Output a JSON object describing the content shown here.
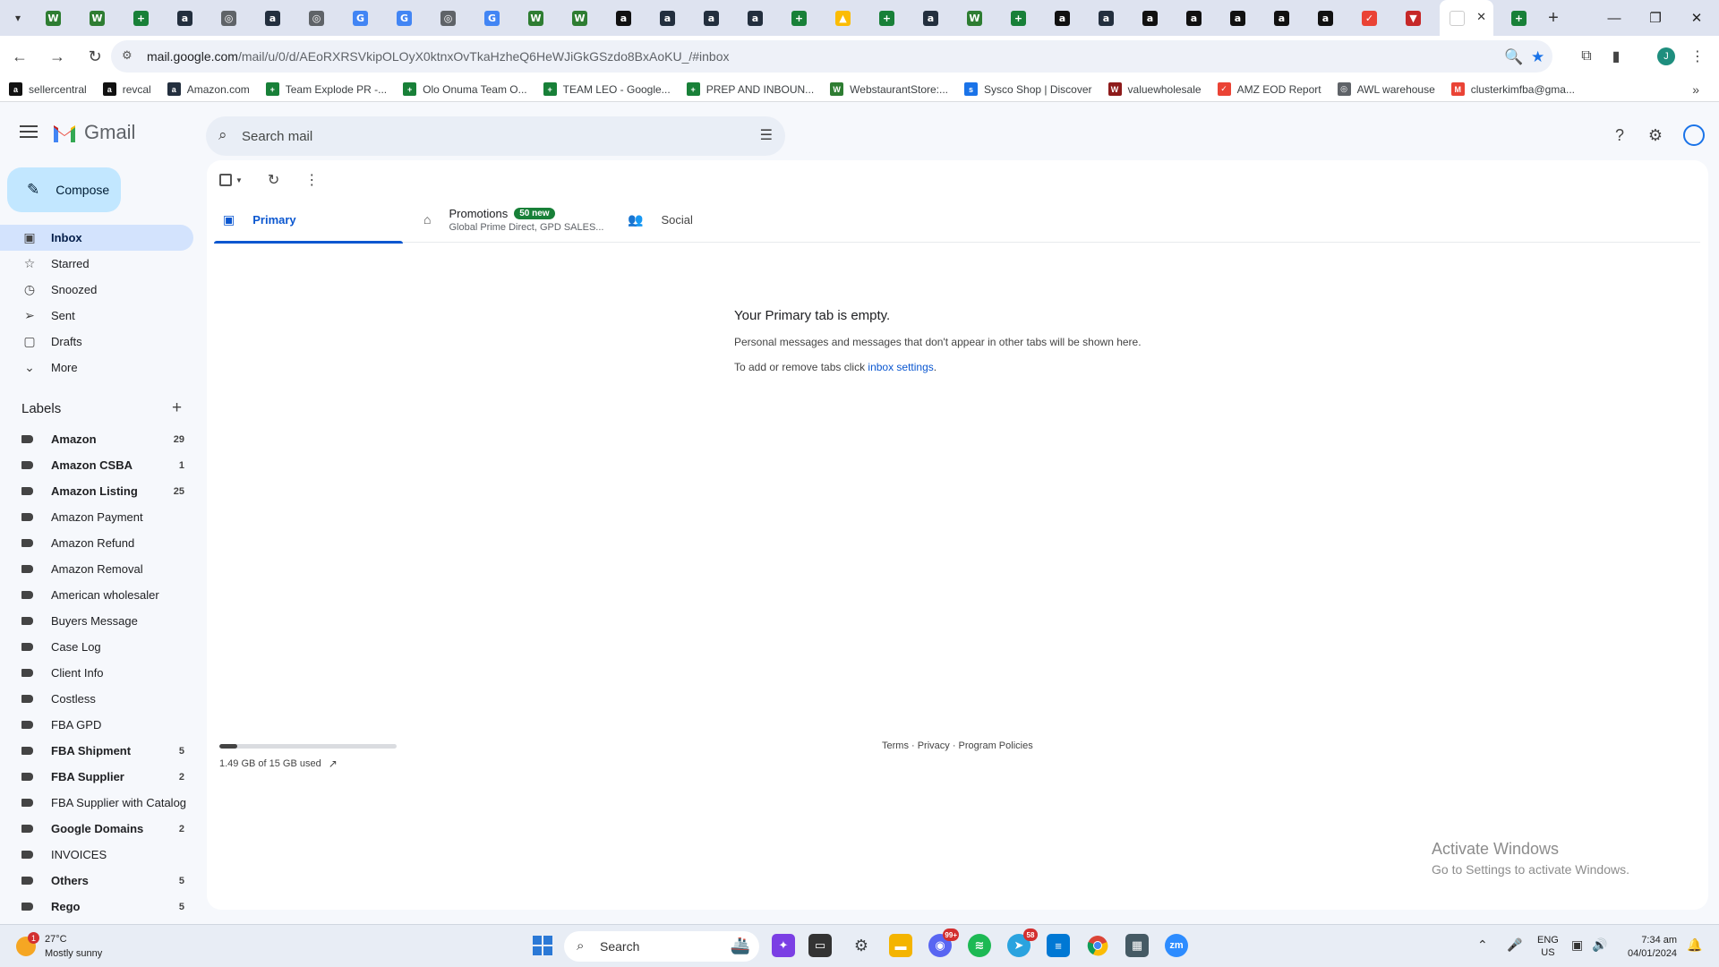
{
  "browser": {
    "tabs": [
      {
        "icon": "webstaurant",
        "color": "#2e7d32"
      },
      {
        "icon": "webstaurant",
        "color": "#2e7d32"
      },
      {
        "icon": "sheets",
        "color": "#188038"
      },
      {
        "icon": "amazon",
        "color": "#232f3e"
      },
      {
        "icon": "globe",
        "color": "#5f6368"
      },
      {
        "icon": "amazon",
        "color": "#232f3e"
      },
      {
        "icon": "globe",
        "color": "#5f6368"
      },
      {
        "icon": "google",
        "color": "#4285f4"
      },
      {
        "icon": "google",
        "color": "#4285f4"
      },
      {
        "icon": "globe",
        "color": "#5f6368"
      },
      {
        "icon": "google",
        "color": "#4285f4"
      },
      {
        "icon": "webstaurant",
        "color": "#2e7d32"
      },
      {
        "icon": "webstaurant",
        "color": "#2e7d32"
      },
      {
        "icon": "amazon-a",
        "color": "#111111"
      },
      {
        "icon": "amazon",
        "color": "#232f3e"
      },
      {
        "icon": "amazon",
        "color": "#232f3e"
      },
      {
        "icon": "amazon",
        "color": "#232f3e"
      },
      {
        "icon": "sheets",
        "color": "#188038"
      },
      {
        "icon": "drive",
        "color": "#fbbc04"
      },
      {
        "icon": "sheets",
        "color": "#188038"
      },
      {
        "icon": "amazon",
        "color": "#232f3e"
      },
      {
        "icon": "webstaurant",
        "color": "#2e7d32"
      },
      {
        "icon": "sheets",
        "color": "#188038"
      },
      {
        "icon": "amazon-a",
        "color": "#111111"
      },
      {
        "icon": "amazon",
        "color": "#232f3e"
      },
      {
        "icon": "amazon-a",
        "color": "#111111"
      },
      {
        "icon": "amazon-a",
        "color": "#111111"
      },
      {
        "icon": "amazon-a",
        "color": "#111111"
      },
      {
        "icon": "amazon-a",
        "color": "#111111"
      },
      {
        "icon": "amazon-a",
        "color": "#111111"
      },
      {
        "icon": "eod",
        "color": "#ea4335"
      },
      {
        "icon": "shield",
        "color": "#c62828"
      }
    ],
    "active_tab_icon": "gmail",
    "url_host": "mail.google.com",
    "url_path": "/mail/u/0/d/AEoRXRSVkipOLOyX0ktnxOvTkaHzheQ6HeWJiGkGSzdo8BxAoKU_/#inbox",
    "profile_initial": "J",
    "bookmarks": [
      {
        "label": "sellercentral",
        "icon": "amazon-a",
        "color": "#111111"
      },
      {
        "label": "revcal",
        "icon": "amazon-a",
        "color": "#111111"
      },
      {
        "label": "Amazon.com",
        "icon": "amazon",
        "color": "#232f3e"
      },
      {
        "label": "Team Explode PR -...",
        "icon": "sheets",
        "color": "#188038"
      },
      {
        "label": "Olo Onuma Team O...",
        "icon": "sheets",
        "color": "#188038"
      },
      {
        "label": "TEAM LEO - Google...",
        "icon": "sheets",
        "color": "#188038"
      },
      {
        "label": "PREP AND INBOUN...",
        "icon": "sheets",
        "color": "#188038"
      },
      {
        "label": "WebstaurantStore:...",
        "icon": "webstaurant",
        "color": "#2e7d32"
      },
      {
        "label": "Sysco Shop | Discover",
        "icon": "sysco",
        "color": "#1a73e8"
      },
      {
        "label": "valuewholesale",
        "icon": "vw",
        "color": "#8e1b1b"
      },
      {
        "label": "AMZ EOD Report",
        "icon": "eod",
        "color": "#ea4335"
      },
      {
        "label": "AWL warehouse",
        "icon": "globe",
        "color": "#5f6368"
      },
      {
        "label": "clusterkimfba@gma...",
        "icon": "gmail",
        "color": "#ea4335"
      }
    ]
  },
  "gmail": {
    "product_name": "Gmail",
    "search_placeholder": "Search mail",
    "compose_label": "Compose",
    "nav": [
      {
        "label": "Inbox",
        "icon": "inbox-icon",
        "active": true
      },
      {
        "label": "Starred",
        "icon": "star-icon"
      },
      {
        "label": "Snoozed",
        "icon": "clock-icon"
      },
      {
        "label": "Sent",
        "icon": "send-icon"
      },
      {
        "label": "Drafts",
        "icon": "draft-icon"
      },
      {
        "label": "More",
        "icon": "chevron-down-icon"
      }
    ],
    "labels_heading": "Labels",
    "labels": [
      {
        "label": "Amazon",
        "count": "29",
        "bold": true
      },
      {
        "label": "Amazon CSBA",
        "count": "1",
        "bold": true
      },
      {
        "label": "Amazon Listing",
        "count": "25",
        "bold": true
      },
      {
        "label": "Amazon Payment",
        "count": "",
        "bold": false
      },
      {
        "label": "Amazon Refund",
        "count": "",
        "bold": false
      },
      {
        "label": "Amazon Removal",
        "count": "",
        "bold": false
      },
      {
        "label": "American wholesaler",
        "count": "",
        "bold": false
      },
      {
        "label": "Buyers Message",
        "count": "",
        "bold": false
      },
      {
        "label": "Case Log",
        "count": "",
        "bold": false
      },
      {
        "label": "Client Info",
        "count": "",
        "bold": false
      },
      {
        "label": "Costless",
        "count": "",
        "bold": false
      },
      {
        "label": "FBA GPD",
        "count": "",
        "bold": false
      },
      {
        "label": "FBA Shipment",
        "count": "5",
        "bold": true
      },
      {
        "label": "FBA Supplier",
        "count": "2",
        "bold": true
      },
      {
        "label": "FBA Supplier with Catalog",
        "count": "",
        "bold": false
      },
      {
        "label": "Google Domains",
        "count": "2",
        "bold": true
      },
      {
        "label": "INVOICES",
        "count": "",
        "bold": false
      },
      {
        "label": "Others",
        "count": "5",
        "bold": true
      },
      {
        "label": "Rego",
        "count": "5",
        "bold": true
      }
    ],
    "tabs": {
      "primary": "Primary",
      "promotions": "Promotions",
      "promotions_badge": "50 new",
      "promotions_sub": "Global Prime Direct, GPD SALES...",
      "social": "Social"
    },
    "empty_title": "Your Primary tab is empty.",
    "empty_line1": "Personal messages and messages that don't appear in other tabs will be shown here.",
    "empty_line2_prefix": "To add or remove tabs click ",
    "empty_link": "inbox settings",
    "empty_line2_suffix": ".",
    "storage_text": "1.49 GB of 15 GB used",
    "storage_fraction": 0.0993,
    "footer": "Terms · Privacy · Program Policies"
  },
  "watermark": {
    "line1": "Activate Windows",
    "line2": "Go to Settings to activate Windows."
  },
  "taskbar": {
    "weather_badge": "1",
    "temperature": "27°C",
    "condition": "Mostly sunny",
    "search_label": "Search",
    "discord_badge": "99+",
    "telegram_badge": "58",
    "lang_top": "ENG",
    "lang_bottom": "US",
    "time": "7:34 am",
    "date": "04/01/2024"
  }
}
